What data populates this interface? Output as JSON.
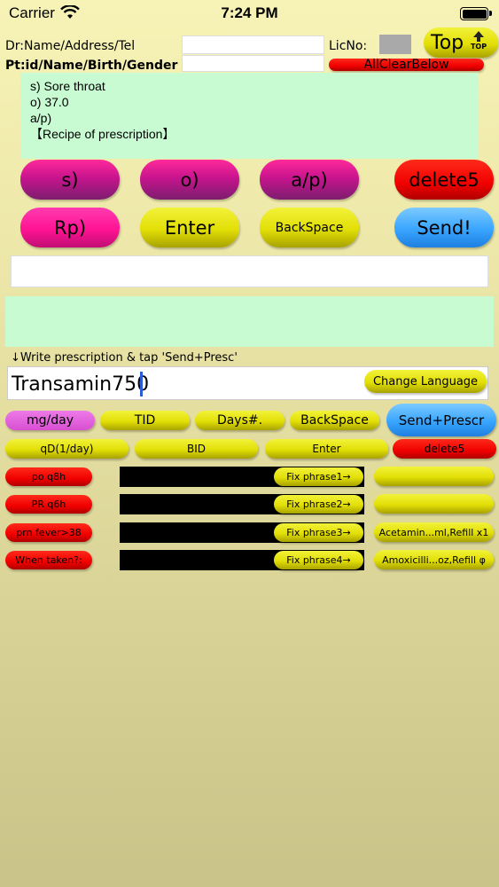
{
  "status_bar": {
    "carrier": "Carrier",
    "time": "7:24 PM"
  },
  "header": {
    "dr_label": "Dr:Name/Address/Tel",
    "pt_label": "Pt:id/Name/Birth/Gender",
    "lic_label": "LicNo:",
    "top_button": "Top",
    "top_small": "TOP",
    "all_clear": "AllClearBelow"
  },
  "notes": {
    "line1": "s) Sore throat",
    "line2": "o) 37.0",
    "line3": "a/p)",
    "line4": "【Recipe of prescription】"
  },
  "keys": {
    "s": "s)",
    "o": "o)",
    "ap": "a/p)",
    "delete5": "delete5",
    "rp": "Rp)",
    "enter": "Enter",
    "backspace": "BackSpace",
    "send": "Send!"
  },
  "instruction": "↓Write prescription & tap 'Send+Presc'",
  "prescription_input": "Transamin750",
  "change_language": "Change Language",
  "dose_row1": {
    "mgday": "mg/day",
    "tid": "TID",
    "days": "Days#.",
    "backspace": "BackSpace",
    "send_presc": "Send+Prescr"
  },
  "dose_row2": {
    "qd": "qD(1/day)",
    "bid": "BID",
    "enter": "Enter",
    "delete5": "delete5"
  },
  "phrases": [
    {
      "tag": "po q8h",
      "fix": "Fix phrase1→",
      "saved": ""
    },
    {
      "tag": "PR q6h",
      "fix": "Fix phrase2→",
      "saved": ""
    },
    {
      "tag": "prn fever>38",
      "fix": "Fix phrase3→",
      "saved": "Acetamin...ml,Refill x1"
    },
    {
      "tag": "When taken?:",
      "fix": "Fix phrase4→",
      "saved": "Amoxicilli...oz,Refill φ"
    }
  ],
  "colors": {
    "green_note": "#c8fbd2",
    "accent_red": "#ff0000",
    "accent_yellow": "#e2df06",
    "accent_blue": "#39a5ff"
  }
}
